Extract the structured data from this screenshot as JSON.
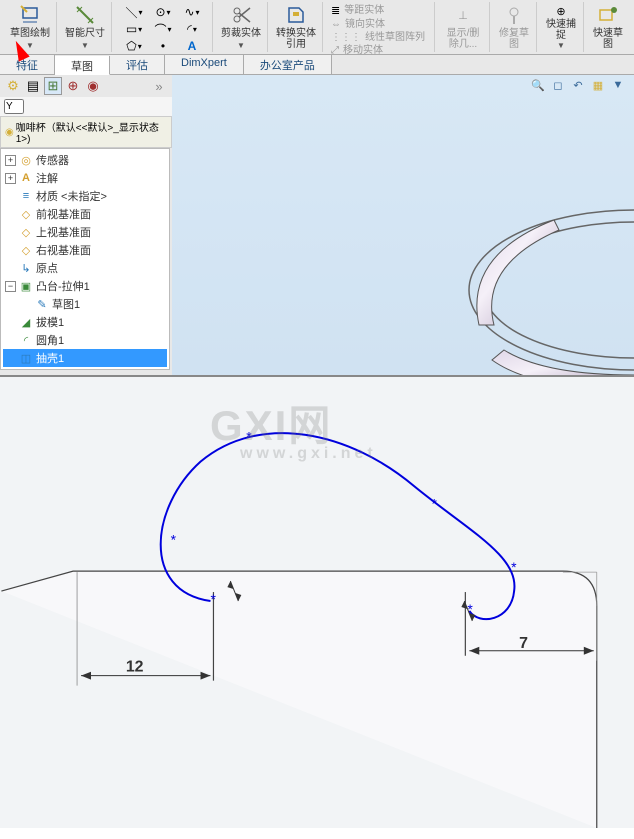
{
  "ribbon": {
    "sketch": "草图绘制",
    "smart_dim": "智能尺寸",
    "trim": "剪裁实体",
    "convert": "转换实体引用",
    "offset": "等距实体",
    "mirror": "镜向实体",
    "linear_pattern": "线性草图阵列",
    "move": "移动实体",
    "show_delete": "显示/删除几...",
    "repair": "修复草图",
    "quick_snap": "快速捕捉",
    "rapid_sketch": "快速草图"
  },
  "tabs": {
    "feature": "特征",
    "sketch": "草图",
    "evaluate": "评估",
    "dimxpert": "DimXpert",
    "office": "办公室产品"
  },
  "filter": "Y",
  "doc_title": "咖啡杯（默认<<默认>_显示状态 1>)",
  "tree": {
    "sensors": "传感器",
    "annotations": "注解",
    "material": "材质 <未指定>",
    "front": "前视基准面",
    "top": "上视基准面",
    "right": "右视基准面",
    "origin": "原点",
    "extrude": "凸台-拉伸1",
    "sketch1": "草图1",
    "draft": "拔模1",
    "fillet": "圆角1",
    "shell": "抽壳1"
  },
  "dims": {
    "d12": "12",
    "d7": "7"
  },
  "watermark": "GXI网",
  "watermark_sub": "www.gxi.net"
}
